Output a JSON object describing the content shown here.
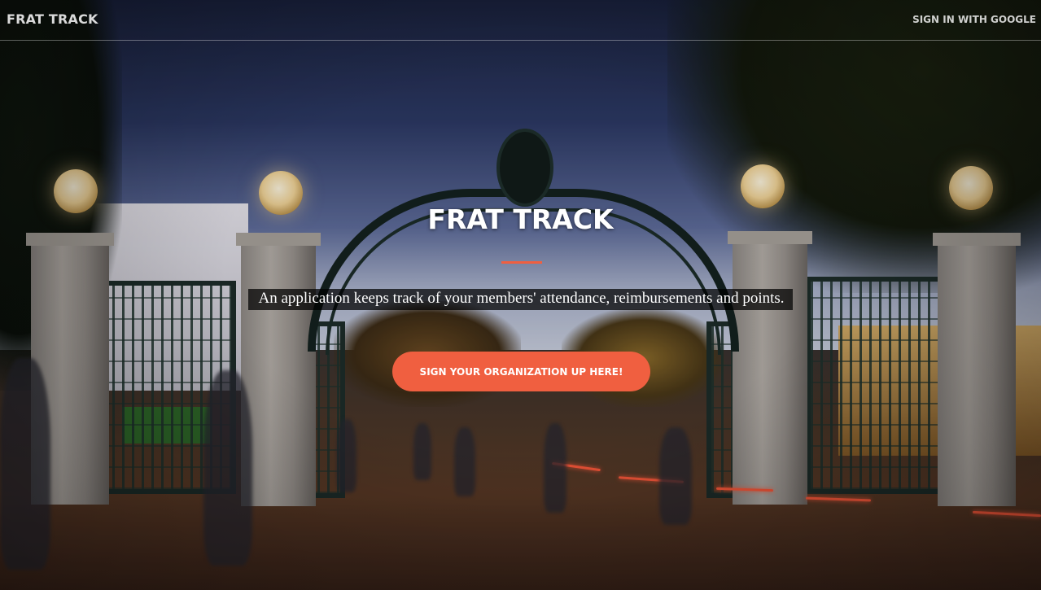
{
  "navbar": {
    "brand": "FRAT TRACK",
    "signin_label": "SIGN IN WITH GOOGLE"
  },
  "hero": {
    "title": "FRAT TRACK",
    "tagline": "An application keeps track of your members' attendance, reimbursements and points.",
    "cta_label": "SIGN YOUR ORGANIZATION UP HERE!"
  },
  "colors": {
    "accent": "#f05f40",
    "text": "#ffffff"
  }
}
